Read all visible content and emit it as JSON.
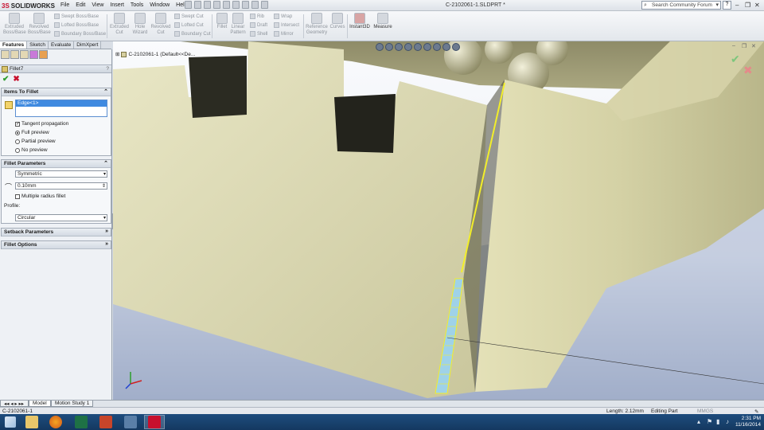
{
  "app": {
    "brand": "SOLIDWORKS",
    "doc_title": "C-2102061-1.SLDPRT *"
  },
  "menu": [
    "File",
    "Edit",
    "View",
    "Insert",
    "Tools",
    "Window",
    "Help"
  ],
  "search": {
    "placeholder": "Search Community Forum"
  },
  "toolbar": {
    "extruded_boss": "Extruded\nBoss/Base",
    "revolved_boss": "Revolved\nBoss/Base",
    "swept_boss": "Swept Boss/Base",
    "lofted_boss": "Lofted Boss/Base",
    "boundary_boss": "Boundary Boss/Base",
    "extruded_cut": "Extruded\nCut",
    "hole_wizard": "Hole\nWizard",
    "revolved_cut": "Revolved\nCut",
    "swept_cut": "Swept Cut",
    "lofted_cut": "Lofted Cut",
    "boundary_cut": "Boundary Cut",
    "fillet": "Fillet",
    "linear_pattern": "Linear\nPattern",
    "rib": "Rib",
    "draft": "Draft",
    "shell": "Shell",
    "wrap": "Wrap",
    "intersect": "Intersect",
    "mirror": "Mirror",
    "reference_geometry": "Reference\nGeometry",
    "curves": "Curves",
    "instant3d": "Instant3D",
    "measure": "Measure"
  },
  "tabs": [
    "Features",
    "Sketch",
    "Evaluate",
    "DimXpert"
  ],
  "property_manager": {
    "title": "Fillet7",
    "items_to_fillet": {
      "header": "Items To Fillet",
      "selection": "Edge<1>",
      "tangent_propagation": "Tangent propagation",
      "full_preview": "Full preview",
      "partial_preview": "Partial preview",
      "no_preview": "No preview"
    },
    "fillet_parameters": {
      "header": "Fillet Parameters",
      "type": "Symmetric",
      "radius": "0.10mm",
      "multiple_radius": "Multiple radius fillet",
      "profile_label": "Profile:",
      "profile": "Circular"
    },
    "setback_parameters": {
      "header": "Setback Parameters"
    },
    "fillet_options": {
      "header": "Fillet Options"
    }
  },
  "viewport": {
    "tree_label": "C-2102061-1  (Default<<De..."
  },
  "bottom_tabs": [
    "Model",
    "Motion Study 1"
  ],
  "status": {
    "part": "C-2102061-1",
    "length": "Length: 2.12mm",
    "mode": "Editing Part",
    "units": "MMGS"
  },
  "taskbar": {
    "time": "2:31 PM",
    "date": "11/16/2014"
  },
  "colors": {
    "selection": "#3f8ae0",
    "edge_highlight": "#f2ee2a",
    "accent_red": "#c8102e",
    "taskbar": "#1e4d7e"
  }
}
